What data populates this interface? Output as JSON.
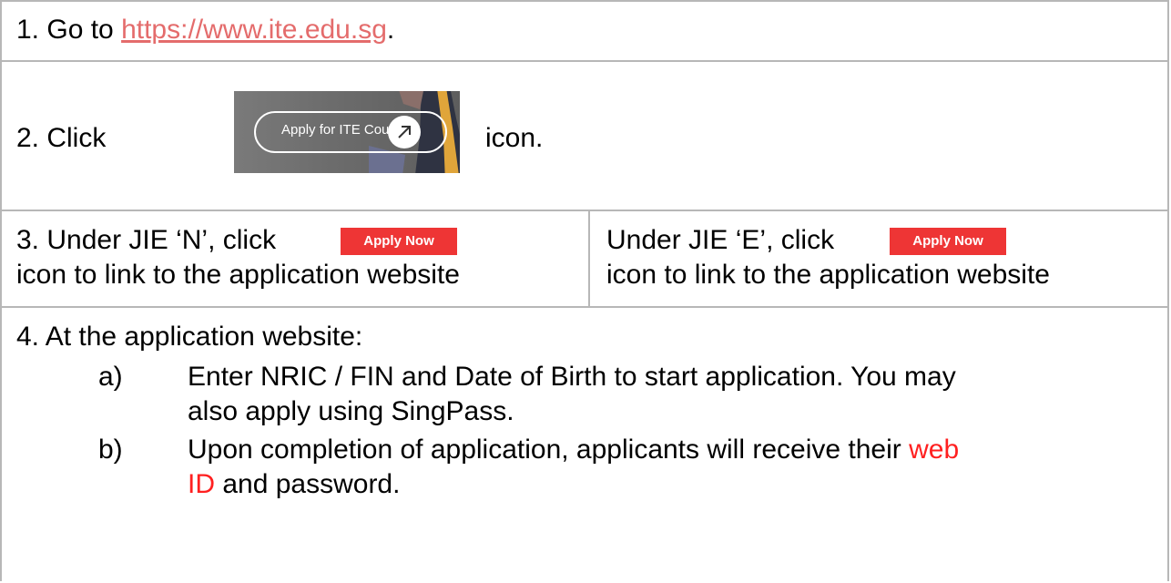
{
  "step1": {
    "prefix": "1.  Go to ",
    "link": "https://www.ite.edu.sg",
    "suffix": "."
  },
  "step2": {
    "prefix": "2. Click",
    "button_label": "Apply for ITE Courses",
    "suffix": "icon."
  },
  "step3": {
    "left": {
      "line1": "3. Under JIE ‘N’, click",
      "button_label": "Apply Now",
      "line2": "icon to link to the application website"
    },
    "right": {
      "line1": "Under JIE ‘E’, click",
      "button_label": "Apply Now",
      "line2": "icon to link to the application website"
    }
  },
  "step4": {
    "heading": "4. At the application website:",
    "items": [
      {
        "marker": "a)",
        "line1": "Enter NRIC / FIN and Date of Birth to start application. You may",
        "line2": "also apply using SingPass."
      },
      {
        "marker": "b)",
        "line1_before": "Upon completion of application, applicants will receive their ",
        "line1_highlight": "web",
        "line2_highlight": "ID",
        "line2_after": " and password."
      }
    ]
  },
  "colors": {
    "link": "#e46c6c",
    "highlight": "#ff2020",
    "apply_now_bg": "#ee3535",
    "border": "#b7b7b7"
  },
  "icons": [
    "arrow-up-right-icon"
  ]
}
